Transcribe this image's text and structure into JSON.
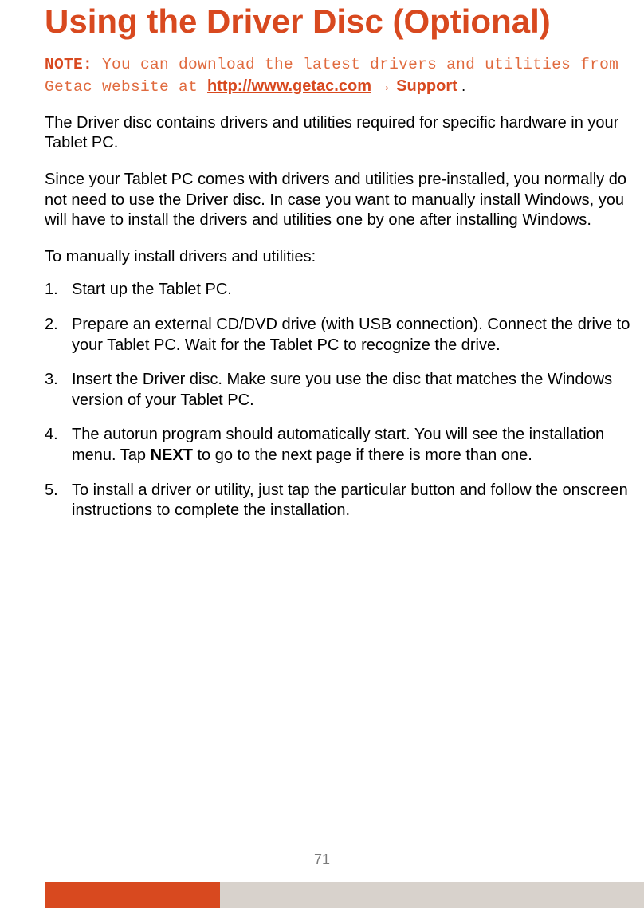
{
  "title": "Using the Driver Disc (Optional)",
  "note": {
    "label": "NOTE:",
    "pre_link": " You can download the latest drivers and utilities from Getac website at ",
    "link_url": "http://www.getac.com",
    "arrow": " → ",
    "support": "Support",
    "period": " ."
  },
  "para1": "The Driver disc contains drivers and utilities required for specific hardware in your Tablet PC.",
  "para2": "Since your Tablet PC comes with drivers and utilities pre-installed, you normally do not need to use the Driver disc. In case you want to manually install Windows, you will have to install the drivers and utilities one by one after installing Windows.",
  "para3": "To manually install drivers and utilities:",
  "steps": {
    "s1": "Start up the Tablet PC.",
    "s2": "Prepare an external CD/DVD drive (with USB connection). Connect the drive to your Tablet PC. Wait for the Tablet PC to recognize the drive.",
    "s3": "Insert the Driver disc. Make sure you use the disc that matches the Windows version of your Tablet PC.",
    "s4a": "The autorun program should automatically start. You will see the installation menu. Tap ",
    "s4_next": "NEXT",
    "s4b": " to go to the next page if there is more than one.",
    "s5": "To install a driver or utility, just tap the particular button and follow the onscreen instructions to complete the installation."
  },
  "page_number": "71"
}
